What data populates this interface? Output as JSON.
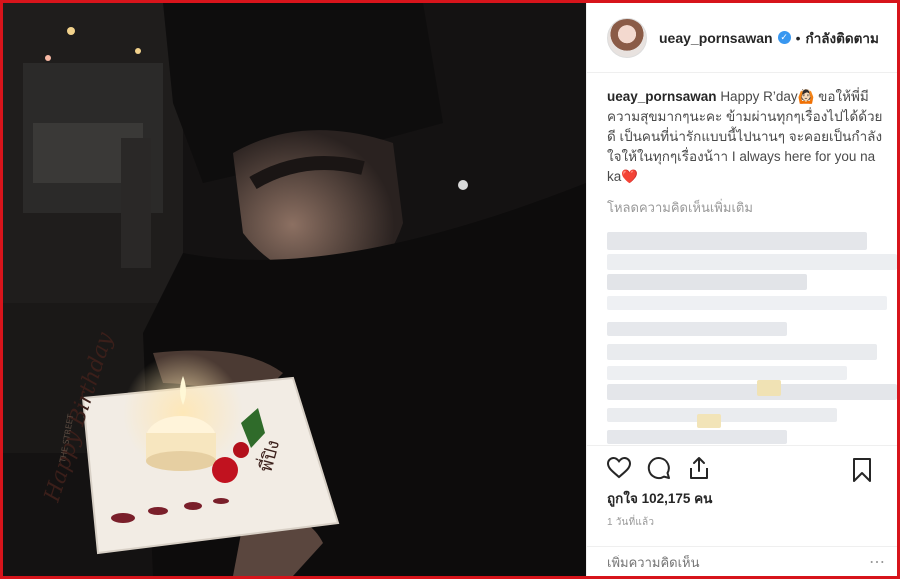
{
  "post": {
    "username": "ueay_pornsawan",
    "verified_icon": "verified-badge-icon",
    "separator": "•",
    "follow_status": "กำลังติดตาม",
    "caption_username": "ueay_pornsawan",
    "caption_text": "Happy R’day🙆🏻 ขอให้พี่มีความสุขมากๆนะคะ ข้ามผ่านทุกๆเรื่องไปได้ด้วยดี เป็นคนที่น่ารักแบบนี้ไปนานๆ จะคอยเป็นกำลังใจให้ในทุกๆเรื่องน้าา I always here for you na ka❤️",
    "load_more": "โหลดความคิดเห็นเพิ่มเติม",
    "likes": "ถูกใจ 102,175 คน",
    "time": "1 วันที่แล้ว",
    "comment_placeholder": "เพิ่มความคิดเห็น"
  },
  "photo": {
    "plate_text": "Happy Birthday",
    "plate_name": "พี่ปิง",
    "brand_text": "THE STREET"
  },
  "icons": [
    "heart-icon",
    "comment-icon",
    "share-icon",
    "bookmark-icon",
    "more-options-icon"
  ],
  "colors": {
    "frame": "#d7141b",
    "verified": "#3897f0"
  }
}
